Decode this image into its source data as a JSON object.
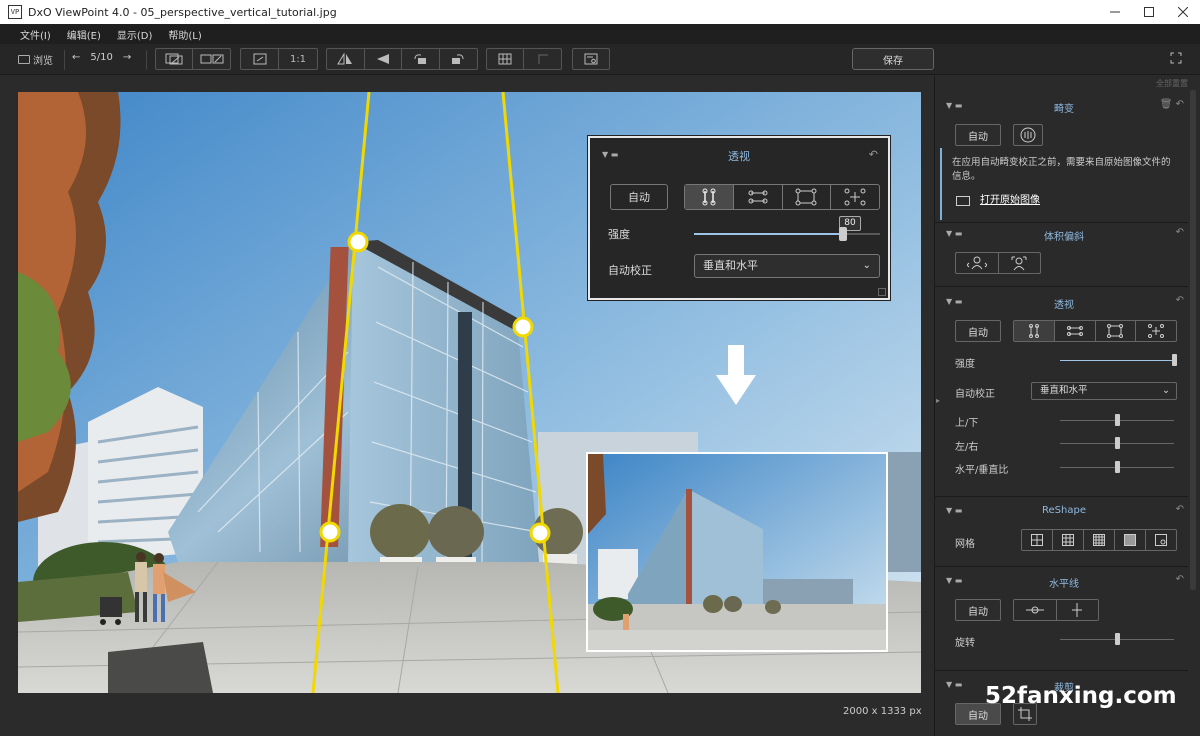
{
  "window": {
    "title": "DxO ViewPoint 4.0 - 05_perspective_vertical_tutorial.jpg",
    "app_icon": "VP",
    "controls": [
      "minimize-icon",
      "maximize-icon",
      "close-icon"
    ]
  },
  "menu": {
    "items": [
      "文件(I)",
      "编辑(E)",
      "显示(D)",
      "帮助(L)"
    ]
  },
  "toolbar": {
    "browse_label": "浏览",
    "counter": "5/10",
    "zoom_1to1": "1:1",
    "save_label": "保存"
  },
  "canvas": {
    "dimensions": "2000 x 1333 px"
  },
  "overlay_panel": {
    "title": "透视",
    "auto_label": "自动",
    "strength_label": "强度",
    "strength_value": "80",
    "strength_fraction": 0.8,
    "auto_correct_label": "自动校正",
    "auto_correct_value": "垂直和水平"
  },
  "right_panel": {
    "reset_all": "全部重置",
    "distortion": {
      "title": "畸变",
      "auto_label": "自动",
      "info_text": "在应用自动畸变校正之前，需要来自原始图像文件的信息。",
      "open_original": "打开原始图像"
    },
    "volume": {
      "title": "体积偏斜"
    },
    "perspective": {
      "title": "透视",
      "auto_label": "自动",
      "strength_label": "强度",
      "auto_correct_label": "自动校正",
      "auto_correct_value": "垂直和水平",
      "up_down_label": "上/下",
      "left_right_label": "左/右",
      "ratio_label": "水平/垂直比"
    },
    "reshape": {
      "title": "ReShape",
      "grid_label": "网格"
    },
    "horizon": {
      "title": "水平线",
      "auto_label": "自动",
      "rotate_label": "旋转"
    },
    "crop": {
      "title": "裁剪",
      "auto_label": "自动"
    }
  },
  "watermark": "52fanxing.com",
  "colors": {
    "accent": "#8fb9e0",
    "guide_line": "#f0d800",
    "background": "#2b2b2b"
  }
}
